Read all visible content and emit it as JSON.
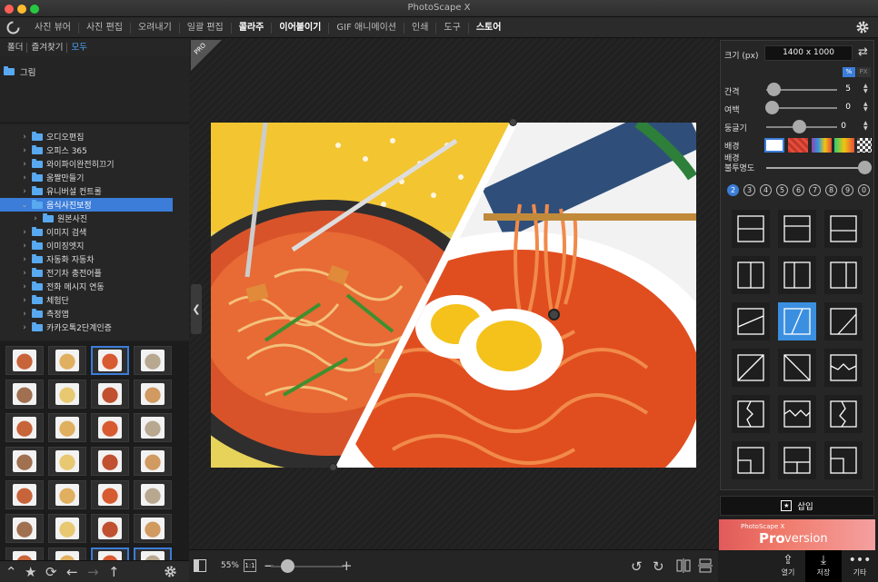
{
  "window": {
    "title": "PhotoScape X",
    "traffic": [
      "#fe5f57",
      "#febc2e",
      "#28c840"
    ]
  },
  "menu": {
    "items": [
      {
        "label": "사진 뷰어",
        "bold": false
      },
      {
        "label": "사진 편집",
        "bold": false
      },
      {
        "label": "오려내기",
        "bold": false
      },
      {
        "label": "일괄 편집",
        "bold": false
      },
      {
        "label": "콜라주",
        "bold": true
      },
      {
        "label": "이어붙이기",
        "bold": true
      },
      {
        "label": "GIF 애니메이션",
        "bold": false
      },
      {
        "label": "인쇄",
        "bold": false
      },
      {
        "label": "도구",
        "bold": false
      },
      {
        "label": "스토어",
        "bold": true
      }
    ]
  },
  "left": {
    "tabs": [
      "폴더",
      "즐겨찾기",
      "모두"
    ],
    "active_tab": "모두",
    "favorite": "그림",
    "tree": [
      {
        "label": "오디오편집",
        "expanded": false,
        "indent": 0
      },
      {
        "label": "오피스 365",
        "expanded": false,
        "indent": 0
      },
      {
        "label": "와이파이완전히끄기",
        "expanded": false,
        "indent": 0
      },
      {
        "label": "움짤만들기",
        "expanded": false,
        "indent": 0
      },
      {
        "label": "유니버설 컨트롤",
        "expanded": false,
        "indent": 0
      },
      {
        "label": "음식사진보정",
        "expanded": true,
        "indent": 0,
        "selected": true
      },
      {
        "label": "원본사진",
        "expanded": false,
        "indent": 1
      },
      {
        "label": "이미지 검색",
        "expanded": false,
        "indent": 0
      },
      {
        "label": "이미징엣지",
        "expanded": false,
        "indent": 0
      },
      {
        "label": "자동화 자동차",
        "expanded": false,
        "indent": 0
      },
      {
        "label": "전기차 충전어플",
        "expanded": false,
        "indent": 0
      },
      {
        "label": "전화 메시지 연동",
        "expanded": false,
        "indent": 0
      },
      {
        "label": "체험단",
        "expanded": false,
        "indent": 0
      },
      {
        "label": "측정앱",
        "expanded": false,
        "indent": 0
      },
      {
        "label": "카카오톡2단계인증",
        "expanded": false,
        "indent": 0
      }
    ]
  },
  "canvas": {
    "badge": "PRO"
  },
  "bottom": {
    "zoom": "55%",
    "one_to_one": "1:1"
  },
  "right": {
    "size_label": "크기 (px)",
    "size_value": "1400 x 1000",
    "unit_percent": "%",
    "unit_px": "PX",
    "spacing_label": "간격",
    "spacing_value": "5",
    "margin_label": "여백",
    "margin_value": "0",
    "round_label": "둥글기",
    "round_value": "0",
    "bg_label": "배경",
    "bg_opacity_label": "배경\n불투명도",
    "counts": [
      "2",
      "3",
      "4",
      "5",
      "6",
      "7",
      "8",
      "9",
      "0"
    ],
    "active_count": "2",
    "insert_label": "삽입",
    "promo_small": "PhotoScape X",
    "promo_pro": "Pro",
    "promo_version": "version",
    "actions": [
      {
        "label": "열기",
        "icon": "share-icon"
      },
      {
        "label": "저장",
        "icon": "download-icon"
      },
      {
        "label": "기타",
        "icon": "more-icon"
      }
    ]
  }
}
